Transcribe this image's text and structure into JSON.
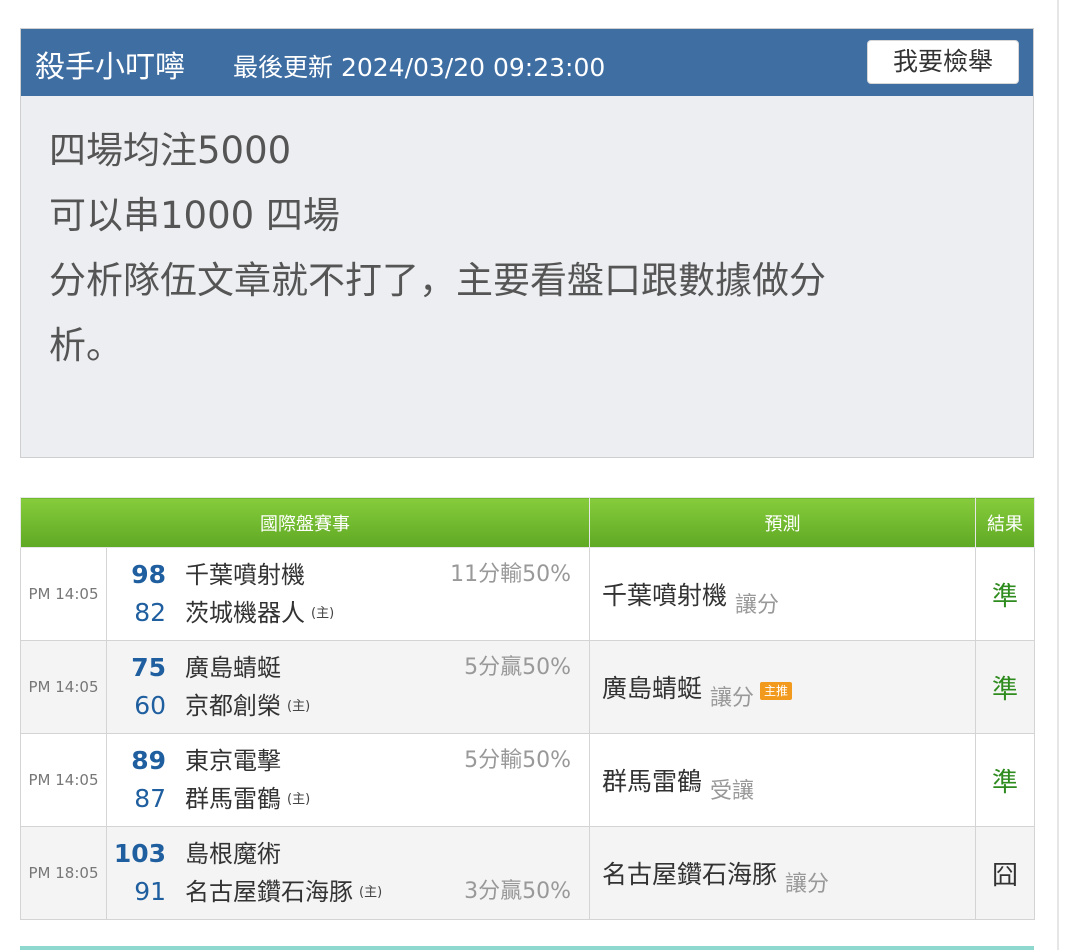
{
  "post": {
    "author": "殺手小叮嚀",
    "updated": "最後更新 2024/03/20 09:23:00",
    "report_button": "我要檢舉",
    "lines": [
      "四場均注5000",
      "可以串1000 四場",
      "分析隊伍文章就不打了，主要看盤口跟數據做分",
      "析。"
    ]
  },
  "table": {
    "headers": {
      "match": "國際盤賽事",
      "prediction": "預測",
      "result": "結果"
    },
    "host_mark": "(主)",
    "rows": [
      {
        "time": "PM 14:05",
        "team1": {
          "score": "98",
          "name": "千葉噴射機"
        },
        "team2": {
          "score": "82",
          "name": "茨城機器人"
        },
        "odds": "11分輸50%",
        "pick": "千葉噴射機",
        "pick_type": "讓分",
        "badge": "",
        "result": "準"
      },
      {
        "time": "PM 14:05",
        "team1": {
          "score": "75",
          "name": "廣島蜻蜓"
        },
        "team2": {
          "score": "60",
          "name": "京都創榮"
        },
        "odds": "5分贏50%",
        "pick": "廣島蜻蜓",
        "pick_type": "讓分",
        "badge": "主推",
        "result": "準"
      },
      {
        "time": "PM 14:05",
        "team1": {
          "score": "89",
          "name": "東京電擊"
        },
        "team2": {
          "score": "87",
          "name": "群馬雷鶴"
        },
        "odds": "5分輸50%",
        "pick": "群馬雷鶴",
        "pick_type": "受讓",
        "badge": "",
        "result": "準"
      },
      {
        "time": "PM 18:05",
        "team1": {
          "score": "103",
          "name": "島根魔術"
        },
        "team2": {
          "score": "91",
          "name": "名古屋鑽石海豚"
        },
        "odds": "3分贏50%",
        "pick": "名古屋鑽石海豚",
        "pick_type": "讓分",
        "badge": "",
        "result": "囧"
      }
    ]
  },
  "colors": {
    "header_blue": "#3f6ea3",
    "table_header_green": "#6cb52b",
    "score_blue": "#1f5f9f",
    "result_green": "#2e8b1e",
    "badge_orange": "#f29a1e"
  }
}
